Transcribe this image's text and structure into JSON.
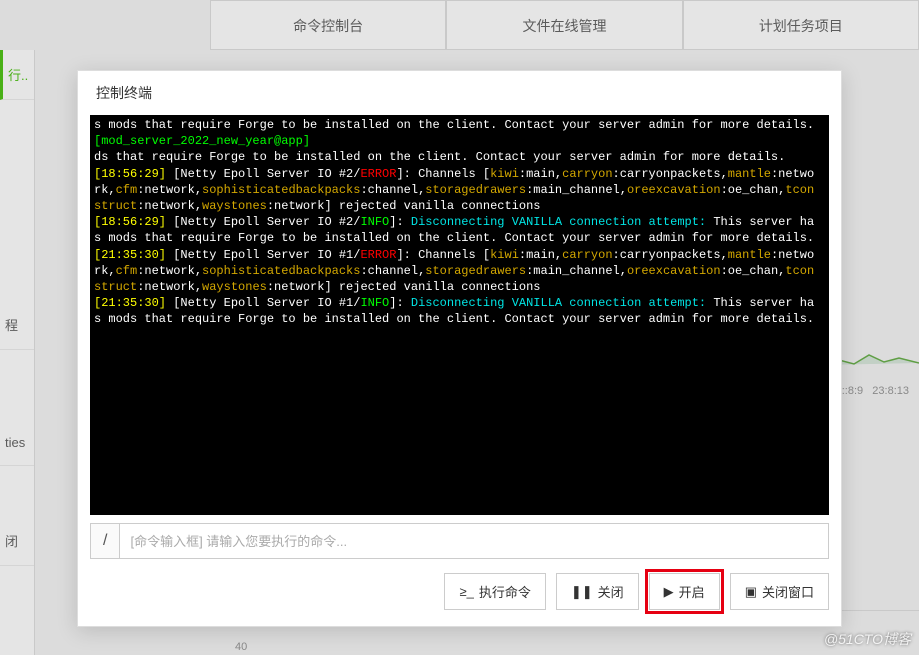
{
  "bg": {
    "tabs": [
      "命令控制台",
      "文件在线管理",
      "计划任务项目"
    ],
    "left_run": "行..",
    "left_items": [
      "程",
      "ties",
      "闭"
    ],
    "times": [
      "::8:9",
      "23:8:13"
    ],
    "num40": "40"
  },
  "modal": {
    "title": "控制终端"
  },
  "term": {
    "l1": "s mods that require Forge to be installed on the client. Contact your server admin for more details.",
    "l2": "[mod_server_2022_new_year@app]",
    "l3": "ds that require Forge to be installed on the client. Contact your server admin for more details.",
    "ts1": "[18:56:29]",
    "netty2": " [Netty Epoll Server IO #2/",
    "netty1": " [Netty Epoll Server IO #1/",
    "err": "ERROR",
    "info": "INFO",
    "ch_a": "]: Channels [",
    "kiwi": "kiwi",
    "main": ":main,",
    "carryon": "carryon",
    "carrypkt": ":carryonpackets,",
    "mantle": "mantle",
    "netwo": ":netwo",
    "rk": "rk,",
    "cfm": "cfm",
    "net": ":network,",
    "sbp": "sophisticatedbackpacks",
    "chan": ":channel,",
    "sd": "storagedrawers",
    "mchan": ":main_channel,",
    "oe": "oreexcavation",
    "oechan": ":oe_chan,",
    "tcon": "tcon",
    "struct": "struct",
    "ws": "waystones",
    "netend": ":network] rejected vanilla connections",
    "disc": "]: ",
    "discx": "Disconnecting VANILLA connection attempt:",
    "srvha": " This server ha",
    "mods": "s mods that require Forge to be installed on the client. Contact your server admin for more details.",
    "ts2": "[21:35:30]"
  },
  "cmd": {
    "prefix": "/",
    "placeholder": "[命令输入框] 请输入您要执行的命令..."
  },
  "buttons": {
    "exec": "执行命令",
    "close": "关闭",
    "start": "开启",
    "closewin": "关闭窗口"
  },
  "watermark": "@51CTO博客"
}
